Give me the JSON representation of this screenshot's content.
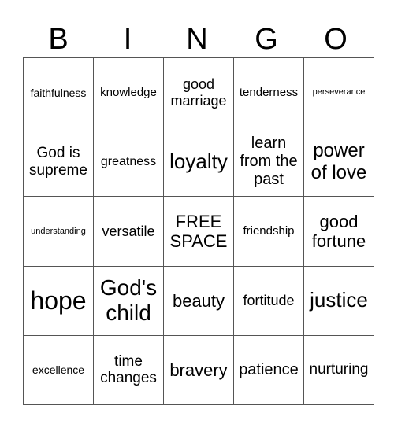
{
  "header": {
    "letters": [
      "B",
      "I",
      "N",
      "G",
      "O"
    ]
  },
  "grid": {
    "rows": [
      [
        "faithfulness",
        "knowledge",
        "good marriage",
        "tenderness",
        "perseverance"
      ],
      [
        "God is supreme",
        "greatness",
        "loyalty",
        "learn from the past",
        "power of love"
      ],
      [
        "understanding",
        "versatile",
        "FREE SPACE",
        "friendship",
        "good fortune"
      ],
      [
        "hope",
        "God's child",
        "beauty",
        "fortitude",
        "justice"
      ],
      [
        "excellence",
        "time changes",
        "bravery",
        "patience",
        "nurturing"
      ]
    ]
  }
}
